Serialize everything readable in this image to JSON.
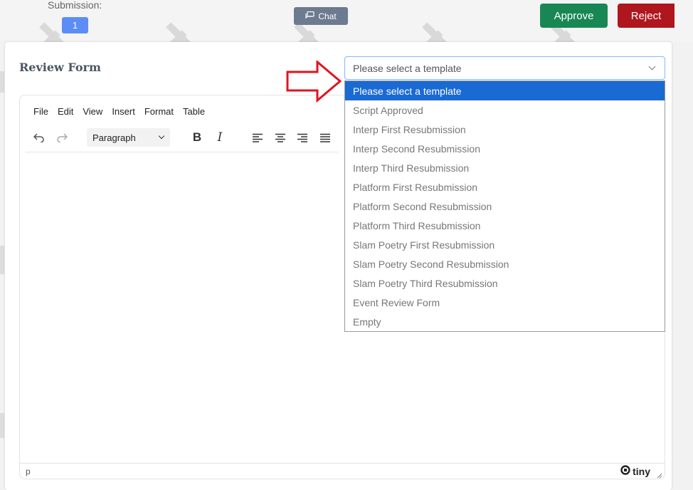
{
  "header": {
    "submission_label": "Submission:",
    "submission_number": "1",
    "chat_label": "Chat",
    "approve_label": "Approve",
    "reject_label": "Reject"
  },
  "review": {
    "title": "Review Form"
  },
  "template_select": {
    "selected_value": "Please select a template",
    "options": [
      "Please select a template",
      "Script Approved",
      "Interp First Resubmission",
      "Interp Second Resubmission",
      "Interp Third Resubmission",
      "Platform First Resubmission",
      "Platform Second Resubmission",
      "Platform Third Resubmission",
      "Slam Poetry First Resubmission",
      "Slam Poetry Second Resubmission",
      "Slam Poetry Third Resubmission",
      "Event Review Form",
      "Empty"
    ]
  },
  "editor": {
    "menu": [
      "File",
      "Edit",
      "View",
      "Insert",
      "Format",
      "Table"
    ],
    "block_format": "Paragraph",
    "status_path": "p",
    "brand": "tiny"
  },
  "colors": {
    "approve": "#198754",
    "reject": "#b0161e",
    "chat": "#6c7b8f",
    "badge": "#5c8df6",
    "selected_option": "#1a6ad4",
    "arrow": "#e0141e"
  }
}
